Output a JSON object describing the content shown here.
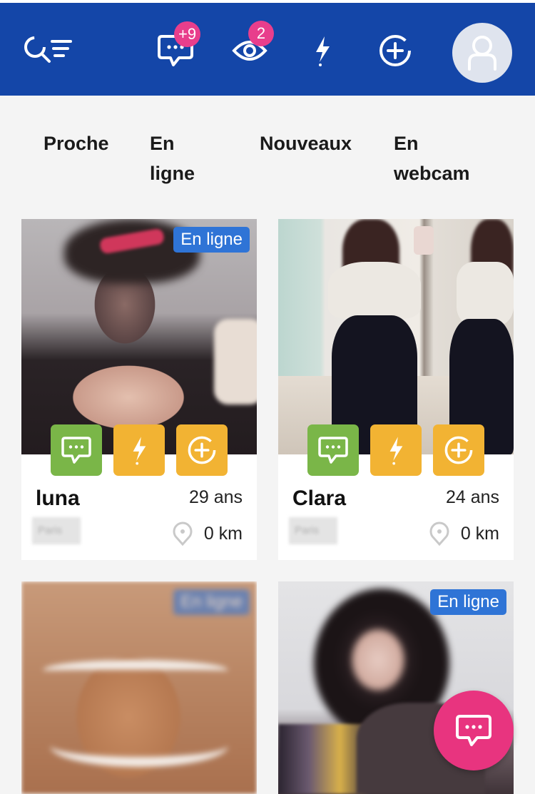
{
  "header": {
    "messages_badge": "+9",
    "visits_badge": "2",
    "icons": [
      "search-filter-icon",
      "chat-icon",
      "eye-icon",
      "flash-icon",
      "add-circle-icon",
      "avatar-icon"
    ]
  },
  "tabs": [
    {
      "label": "Proche"
    },
    {
      "label": "En ligne"
    },
    {
      "label": "Nouveaux"
    },
    {
      "label": "En webcam"
    }
  ],
  "profiles": [
    {
      "name": "luna",
      "age": "29 ans",
      "city": "Paris",
      "distance": "0 km",
      "status": "En ligne"
    },
    {
      "name": "Clara",
      "age": "24 ans",
      "city": "Paris",
      "distance": "0 km",
      "status": ""
    },
    {
      "status": "En ligne"
    },
    {
      "status": "En ligne"
    }
  ],
  "colors": {
    "header": "#1446a8",
    "badge": "#e83e8c",
    "online": "#2f74d6",
    "chat_button": "#7ab648",
    "action_button": "#f2b333",
    "fab": "#e8347f"
  }
}
